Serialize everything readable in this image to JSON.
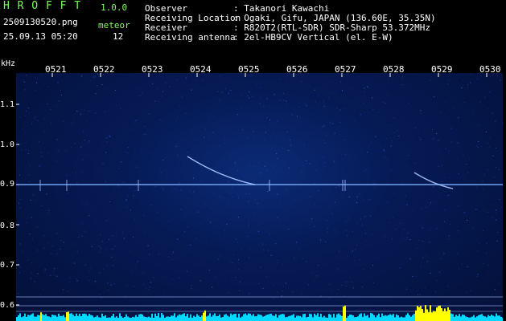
{
  "app": {
    "name": "H R O F F T",
    "version": "1.0.0"
  },
  "file": {
    "name": "2509130520.png",
    "datetime": "25.09.13 05:20"
  },
  "meteor": {
    "label": "meteor",
    "count": "12"
  },
  "info": [
    {
      "key": "Observer",
      "value": ": Takanori Kawachi"
    },
    {
      "key": "Receiving Location",
      "value": ": Ogaki, Gifu, JAPAN (136.60E, 35.35N)"
    },
    {
      "key": "Receiver",
      "value": ": R820T2(RTL-SDR) SDR-Sharp 53.372MHz"
    },
    {
      "key": "Receiving antenna",
      "value": ": 2el-HB9CV Vertical (el. E-W)"
    }
  ],
  "chart_data": {
    "type": "heatmap",
    "ylabel": "kHz",
    "y_ticks": [
      "1.1",
      "1.0",
      "0.9",
      "0.8",
      "0.7",
      "0.6"
    ],
    "x_ticks": [
      "0521",
      "0522",
      "0523",
      "0524",
      "0525",
      "0526",
      "0527",
      "0528",
      "0529",
      "0530"
    ],
    "carrier_khz": 0.9,
    "echoes": [
      {
        "start_time": "0523.8",
        "end_time": "0525.2",
        "start_khz": 0.97,
        "end_khz": 0.9
      },
      {
        "start_time": "0528.5",
        "end_time": "0529.3",
        "start_khz": 0.93,
        "end_khz": 0.89
      }
    ],
    "colors": {
      "background": "#061a55",
      "carrier": "#7fb2ff",
      "meter": "#00d8ff",
      "meter_peak": "#ffff00"
    }
  }
}
